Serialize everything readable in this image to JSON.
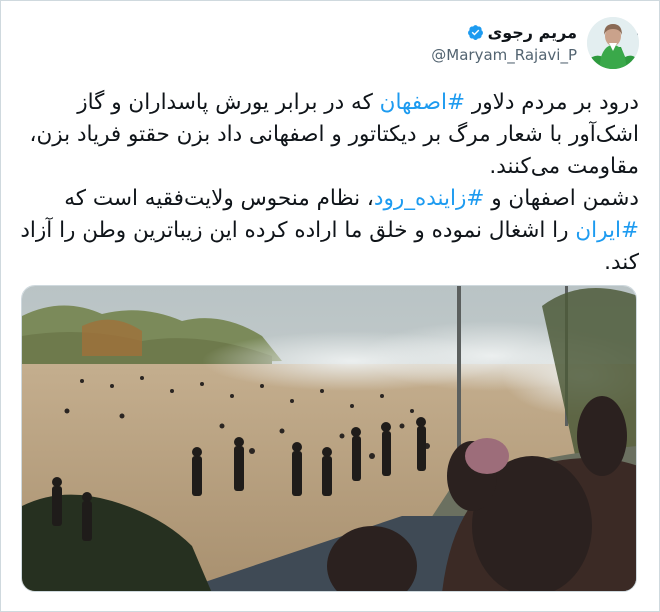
{
  "author": {
    "display_name": "مریم رجوی",
    "handle": "@Maryam_Rajavi_P",
    "verified": true,
    "avatar_icon": "profile-photo-icon"
  },
  "menu": {
    "icon": "more-options-icon"
  },
  "tweet": {
    "segments": [
      {
        "text": "درود بر مردم دلاور ",
        "type": "text"
      },
      {
        "text": "#اصفهان",
        "type": "hashtag"
      },
      {
        "text": " که در برابر یورش پاسداران و گاز اشک‌آور با شعار مرگ بر دیکتاتور و اصفهانی داد بزن حقتو فریاد بزن، مقاومت می‌کنند.\nدشمن اصفهان و ",
        "type": "text"
      },
      {
        "text": "#زاینده_رود",
        "type": "hashtag"
      },
      {
        "text": "، نظام منحوس ولایت‌فقیه است که ",
        "type": "text"
      },
      {
        "text": "#ایران",
        "type": "hashtag"
      },
      {
        "text": " را اشغال نموده و خلق ما اراده کرده این زیباترین وطن را آزاد کند.",
        "type": "text"
      }
    ]
  },
  "colors": {
    "hashtag": "#1d9bf0",
    "verified": "#1d9bf0",
    "text": "#0f1419",
    "secondary": "#536471"
  },
  "media": {
    "icon": "attached-photo-crowd-protest"
  }
}
